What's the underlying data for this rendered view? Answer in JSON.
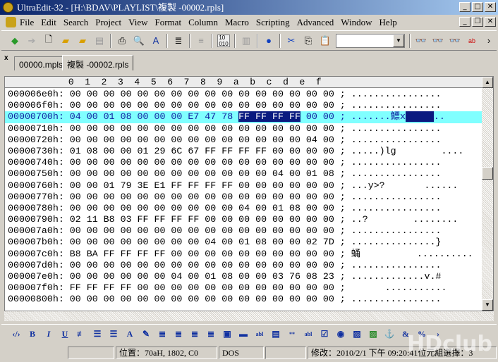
{
  "window": {
    "title": "UltraEdit-32 - [H:\\BDAV\\PLAYLIST\\複製 -00002.rpls]"
  },
  "menu": [
    "File",
    "Edit",
    "Search",
    "Project",
    "View",
    "Format",
    "Column",
    "Macro",
    "Scripting",
    "Advanced",
    "Window",
    "Help"
  ],
  "tabs": [
    {
      "label": "00000.mpls"
    },
    {
      "label": "複製 -00002.rpls",
      "active": true
    }
  ],
  "hex_header": "           0  1  2  3  4  5  6  7  8  9  a  b  c  d  e  f",
  "rows": [
    {
      "addr": "000006e0h:",
      "hex": "00 00 00 00 00 00 00 00 00 00 00 00 00 00 00 00",
      "ascii": "................"
    },
    {
      "addr": "000006f0h:",
      "hex": "00 00 00 00 00 00 00 00 00 00 00 00 00 00 00 00",
      "ascii": "................"
    },
    {
      "addr": "00000700h:",
      "hex": "04 00 01 08 00 00 00 E7 47 78 FF FF FF FF 00 00",
      "ascii": ".......鰾x     ..",
      "current": true
    },
    {
      "addr": "00000710h:",
      "hex": "00 00 00 00 00 00 00 00 00 00 00 00 00 00 00 00",
      "ascii": "................"
    },
    {
      "addr": "00000720h:",
      "hex": "00 00 00 00 00 00 00 00 00 00 00 00 00 00 04 00",
      "ascii": "................"
    },
    {
      "addr": "00000730h:",
      "hex": "01 08 00 00 01 29 6C 67 FF FF FF FF 00 00 00 00",
      "ascii": ".....)lg        ...."
    },
    {
      "addr": "00000740h:",
      "hex": "00 00 00 00 00 00 00 00 00 00 00 00 00 00 00 00",
      "ascii": "................"
    },
    {
      "addr": "00000750h:",
      "hex": "00 00 00 00 00 00 00 00 00 00 00 00 04 00 01 08",
      "ascii": "................"
    },
    {
      "addr": "00000760h:",
      "hex": "00 00 01 79 3E E1 FF FF FF FF 00 00 00 00 00 00",
      "ascii": "...y>?       ......"
    },
    {
      "addr": "00000770h:",
      "hex": "00 00 00 00 00 00 00 00 00 00 00 00 00 00 00 00",
      "ascii": "................"
    },
    {
      "addr": "00000780h:",
      "hex": "00 00 00 00 00 00 00 00 00 00 04 00 01 08 00 00",
      "ascii": "................"
    },
    {
      "addr": "00000790h:",
      "hex": "02 11 B8 03 FF FF FF FF 00 00 00 00 00 00 00 00",
      "ascii": "..?        ........"
    },
    {
      "addr": "000007a0h:",
      "hex": "00 00 00 00 00 00 00 00 00 00 00 00 00 00 00 00",
      "ascii": "................"
    },
    {
      "addr": "000007b0h:",
      "hex": "00 00 00 00 00 00 00 00 04 00 01 08 00 00 02 7D",
      "ascii": "...............}"
    },
    {
      "addr": "000007c0h:",
      "hex": "B8 BA FF FF FF FF 00 00 00 00 00 00 00 00 00 00",
      "ascii": "蛹          .........."
    },
    {
      "addr": "000007d0h:",
      "hex": "00 00 00 00 00 00 00 00 00 00 00 00 00 00 00 00",
      "ascii": "................"
    },
    {
      "addr": "000007e0h:",
      "hex": "00 00 00 00 00 00 04 00 01 08 00 00 03 76 08 23",
      "ascii": ".............v.#"
    },
    {
      "addr": "000007f0h:",
      "hex": "FF FF FF FF 00 00 00 00 00 00 00 00 00 00 00 00",
      "ascii": "      ..........."
    },
    {
      "addr": "00000800h:",
      "hex": "00 00 00 00 00 00 00 00 00 00 00 00 00 00 00 00",
      "ascii": "................"
    }
  ],
  "status": {
    "position": "位置：70aH, 1802, C0",
    "format": "DOS",
    "modified": "修改：2010/2/1 下午 09:20:41",
    "selection": "位元組選擇：3"
  },
  "watermark": "HDclub"
}
